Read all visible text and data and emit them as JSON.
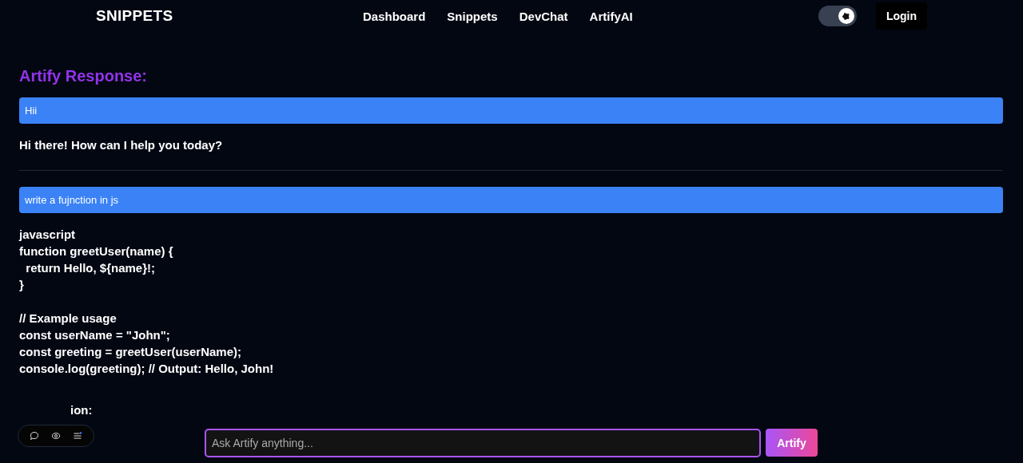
{
  "nav": {
    "brand": "SNIPPETS",
    "links": [
      "Dashboard",
      "Snippets",
      "DevChat",
      "ArtifyAI"
    ],
    "theme_toggle": {
      "on": true
    },
    "login": "Login"
  },
  "heading": "Artify Response:",
  "messages": [
    {
      "prompt": "Hii",
      "response": [
        [
          "Hi there! How can I help you today?"
        ]
      ]
    },
    {
      "prompt": "write a fujnction in js",
      "response": [
        [
          "javascript",
          "function greetUser(name) {",
          "  return Hello, ${name}!;",
          "}"
        ],
        [
          "// Example usage",
          "const userName = \"John\";",
          "const greeting = greetUser(userName);",
          "console.log(greeting); // Output: Hello, John!"
        ]
      ],
      "trailing_heading": "ion:"
    }
  ],
  "composer": {
    "placeholder": "Ask Artify anything...",
    "button": "Artify"
  }
}
